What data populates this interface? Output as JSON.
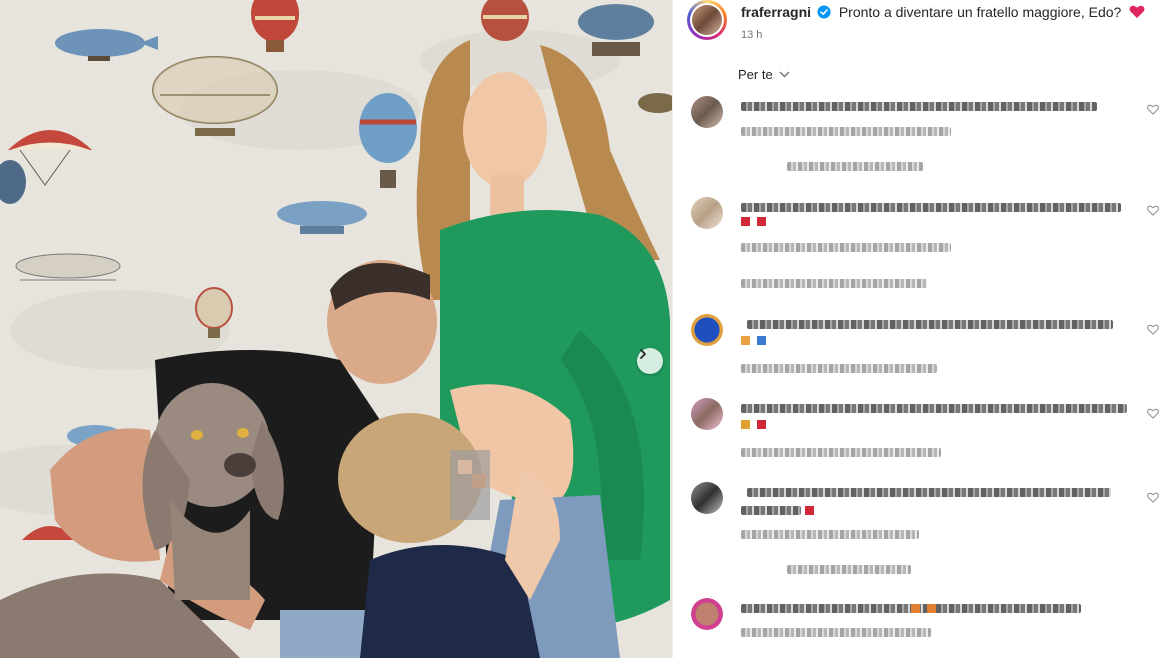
{
  "post": {
    "username": "fraferragni",
    "caption": "Pronto a diventare un fratello maggiore, Edo?",
    "time": "13 h",
    "verified": true
  },
  "comments_sort": {
    "label": "Per te"
  },
  "colors": {
    "heart": "#e0245e",
    "verified_badge": "#0095f6",
    "text_primary": "#262626",
    "text_secondary": "#737373",
    "sweater_green": "#1f9a5c",
    "wallpaper": "#e9e6df"
  },
  "icons": [
    "verified-badge-icon",
    "red-heart-emoji",
    "chevron-down-icon",
    "chevron-right-icon",
    "heart-outline-icon"
  ]
}
